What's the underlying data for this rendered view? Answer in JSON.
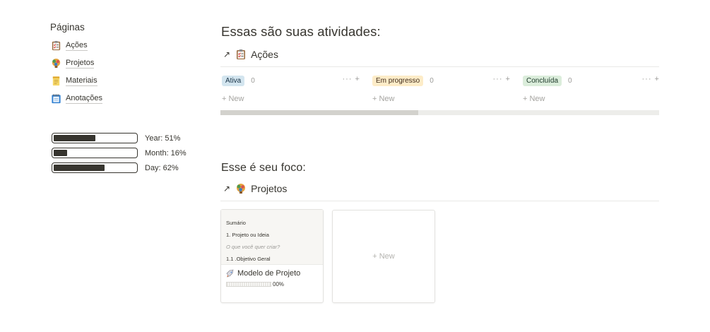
{
  "sidebar": {
    "title": "Páginas",
    "items": [
      {
        "label": "Ações",
        "icon": "checklist-icon"
      },
      {
        "label": "Projetos",
        "icon": "brain-icon"
      },
      {
        "label": "Materiais",
        "icon": "notepad-icon"
      },
      {
        "label": "Anotações",
        "icon": "spiral-notebook-icon"
      }
    ]
  },
  "progress": [
    {
      "label": "Year: 51%",
      "value": 0.51
    },
    {
      "label": "Month: 16%",
      "value": 0.16
    },
    {
      "label": "Day: 62%",
      "value": 0.62
    }
  ],
  "section1": {
    "heading": "Essas são suas atividades:",
    "db_title": "Ações",
    "columns": [
      {
        "tag": "Ativa",
        "count": "0",
        "tag_bg": "#d3e5ef",
        "tag_fg": "#183347",
        "new": "+ New",
        "tools": "··· +"
      },
      {
        "tag": "Em progresso",
        "count": "0",
        "tag_bg": "#fdecc8",
        "tag_fg": "#402c1b",
        "new": "+ New",
        "tools": "··· +"
      },
      {
        "tag": "Concluída",
        "count": "0",
        "tag_bg": "#dbeddb",
        "tag_fg": "#1c3829",
        "new": "+ New",
        "tools": "··· +"
      }
    ]
  },
  "section2": {
    "heading": "Esse é seu foco:",
    "db_title": "Projetos",
    "card": {
      "cover_lines": [
        "Sumário",
        "1. Projeto ou Ideia",
        "O que você quer criar?",
        "1.1 .Objetivo Geral"
      ],
      "title": "Modelo de Projeto",
      "progress_label": "00%",
      "progress_value": 0
    },
    "new_card": "+ New"
  }
}
